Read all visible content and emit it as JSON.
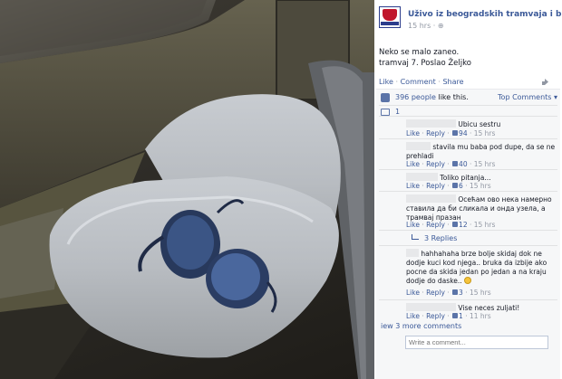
{
  "post": {
    "page_name": "Uživo iz beogradskih tramvaja i buseva",
    "time": "15 hrs",
    "text_line1": "Neko se malo zaneo.",
    "text_line2": "tramvaj 7. Poslao Željko",
    "actions": {
      "like": "Like",
      "comment": "Comment",
      "share": "Share"
    },
    "share_icon": "share-icon"
  },
  "ufi": {
    "likes_count": "396 people",
    "likes_suffix": "like this.",
    "top_comments": "Top Comments",
    "share_count": "1",
    "comments": [
      {
        "text": "Ubicu sestru",
        "like": "Like",
        "reply": "Reply",
        "likes": "94",
        "time": "15 hrs"
      },
      {
        "text": "stavila mu baba pod dupe, da se ne prehladi",
        "like": "Like",
        "reply": "Reply",
        "likes": "40",
        "time": "15 hrs"
      },
      {
        "text": "Toliko pitanja...",
        "like": "Like",
        "reply": "Reply",
        "likes": "6",
        "time": "15 hrs"
      },
      {
        "text": "Осећам ово нека намерно ставила да би сликала и онда узела, а трамвај празан",
        "like": "Like",
        "reply": "Reply",
        "likes": "12",
        "time": "15 hrs"
      },
      {
        "text": "hahhahaha brze bolje skidaj dok ne dodje kuci kod njega.. bruka da izbije ako pocne da skida jedan po jedan a na kraju dodje do daske..",
        "like": "Like",
        "reply": "Reply",
        "likes": "3",
        "time": "15 hrs"
      },
      {
        "text": "Vise neces zuljati!",
        "like": "Like",
        "reply": "Reply",
        "likes": "1",
        "time": "11 hrs"
      }
    ],
    "replies_label": "3 Replies",
    "view_more": "iew 3 more comments",
    "write_placeholder": "Write a comment..."
  },
  "colors": {
    "link": "#3b5998",
    "muted": "#9197a3",
    "panel_bg": "#f6f7f8"
  }
}
